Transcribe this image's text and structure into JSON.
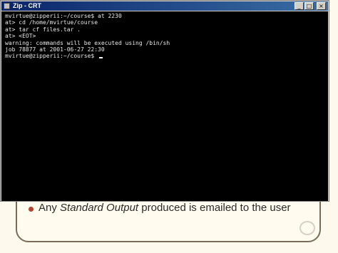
{
  "window": {
    "title": "Zip - CRT"
  },
  "title_buttons": {
    "minimize": "_",
    "maximize": "□",
    "close": "×"
  },
  "terminal": {
    "lines": [
      "mvirtue@zipperii:~/course$ at 2230",
      "at> cd /home/mvirtue/course",
      "at> tar cf files.tar .",
      "at> <EOT>",
      "warning: commands will be executed using /bin/sh",
      "job 78877 at 2001-06-27 22:30",
      "mvirtue@zipperii:~/course$ "
    ]
  },
  "slide": {
    "bullet_prefix": "Any ",
    "bullet_emphasis": "Standard Output",
    "bullet_suffix": " produced is emailed to the user"
  },
  "colors": {
    "titlebar": "#0a246a",
    "terminal_bg": "#000000",
    "terminal_fg": "#e8e8e8",
    "slide_bullet": "#b4432f"
  }
}
